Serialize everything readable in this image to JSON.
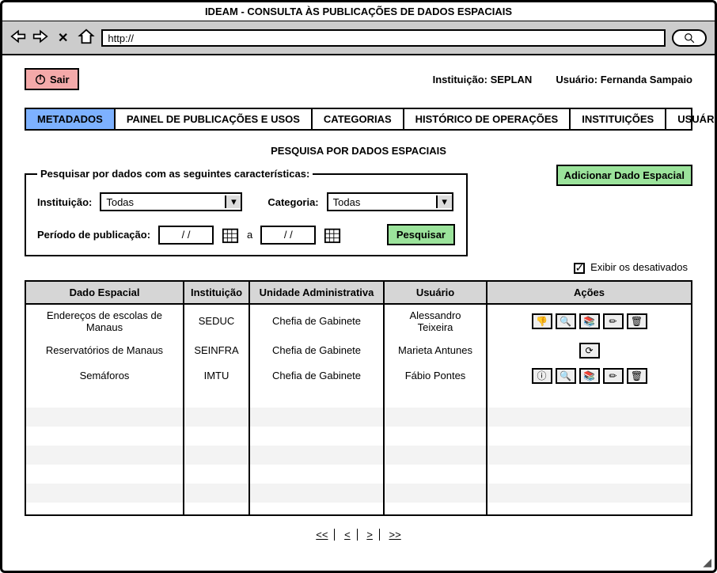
{
  "window": {
    "title": "IDEAM - CONSULTA ÀS PUBLICAÇÕES DE DADOS ESPACIAIS",
    "url": "http://"
  },
  "header": {
    "exit_label": "Sair",
    "institution_label": "Instituição:",
    "institution_value": "SEPLAN",
    "user_label": "Usuário:",
    "user_value": "Fernanda Sampaio"
  },
  "tabs": [
    {
      "label": "METADADOS",
      "active": true
    },
    {
      "label": "PAINEL DE PUBLICAÇÕES E USOS"
    },
    {
      "label": "CATEGORIAS"
    },
    {
      "label": "HISTÓRICO DE OPERAÇÕES"
    },
    {
      "label": "INSTITUIÇÕES"
    },
    {
      "label": "USUÁRIOS"
    }
  ],
  "page": {
    "title": "PESQUISA POR DADOS ESPACIAIS",
    "add_button": "Adicionar Dado Espacial"
  },
  "search": {
    "legend": "Pesquisar por dados com as seguintes características:",
    "institution_label": "Instituição:",
    "institution_value": "Todas",
    "category_label": "Categoria:",
    "category_value": "Todas",
    "period_label": "Período de publicação:",
    "date_from": "/   /",
    "date_to": "/   /",
    "between": "a",
    "submit": "Pesquisar"
  },
  "filters": {
    "show_disabled_label": "Exibir os desativados",
    "show_disabled_checked": true
  },
  "table": {
    "headers": [
      "Dado Espacial",
      "Instituição",
      "Unidade Administrativa",
      "Usuário",
      "Ações"
    ],
    "rows": [
      {
        "data": "Endereços de escolas de Manaus",
        "inst": "SEDUC",
        "unit": "Chefia de Gabinete",
        "user": "Alessandro Teixeira",
        "actions": "full"
      },
      {
        "data": "Reservatórios de Manaus",
        "inst": "SEINFRA",
        "unit": "Chefia de Gabinete",
        "user": "Marieta Antunes",
        "actions": "restore"
      },
      {
        "data": "Semáforos",
        "inst": "IMTU",
        "unit": "Chefia de Gabinete",
        "user": "Fábio Pontes",
        "actions": "full-alt"
      }
    ]
  },
  "pager": {
    "first": "<<",
    "prev": "<",
    "next": ">",
    "last": ">>"
  },
  "icons": {
    "thumb_down": "👎",
    "magnifier": "🔍",
    "layers": "📚",
    "pencil": "✏",
    "trash": "🗑",
    "refresh": "⟳",
    "info": "ⓘ"
  }
}
